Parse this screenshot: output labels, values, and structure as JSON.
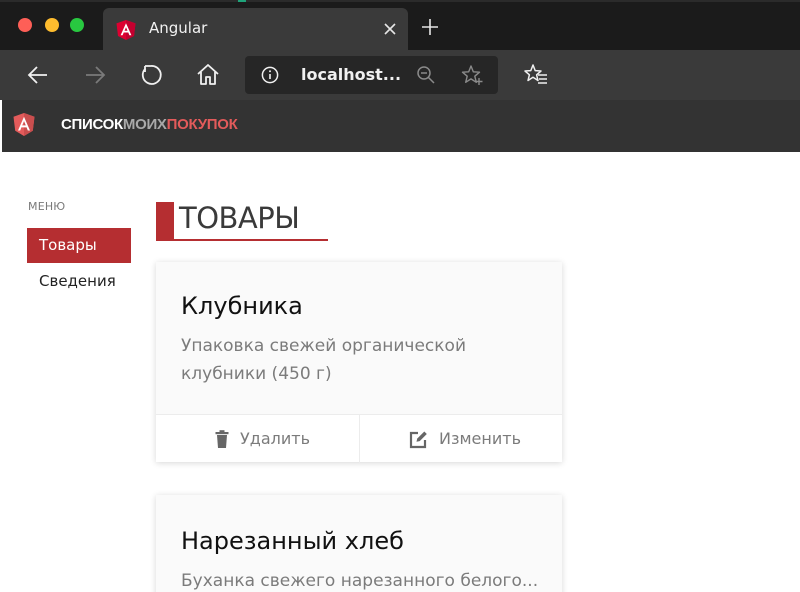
{
  "browser": {
    "tab": {
      "title": "Angular",
      "favicon": "angular-icon"
    },
    "address": {
      "url": "localhost..."
    },
    "icons": [
      "back-icon",
      "forward-icon",
      "refresh-icon",
      "home-icon",
      "info-icon",
      "zoom-icon",
      "star-add-icon",
      "favorites-icon",
      "close-icon",
      "plus-icon"
    ]
  },
  "app": {
    "brand": {
      "part1": "СПИСОК",
      "part2": "МОИХ",
      "part3": "ПОКУПОК"
    },
    "colors": {
      "accent": "#b52e31",
      "brand_red": "#e35b5b",
      "toolbar": "#333333"
    }
  },
  "sidebar": {
    "heading": "МЕНЮ",
    "items": [
      {
        "label": "Товары",
        "active": true
      },
      {
        "label": "Сведения",
        "active": false
      }
    ]
  },
  "main": {
    "title": "ТОВАРЫ",
    "products": [
      {
        "name": "Клубника",
        "description": "Упаковка свежей органической клубники (450 г)",
        "delete_label": "Удалить",
        "edit_label": "Изменить"
      },
      {
        "name": "Нарезанный хлеб",
        "description": "Буханка свежего нарезанного белого..."
      }
    ]
  }
}
